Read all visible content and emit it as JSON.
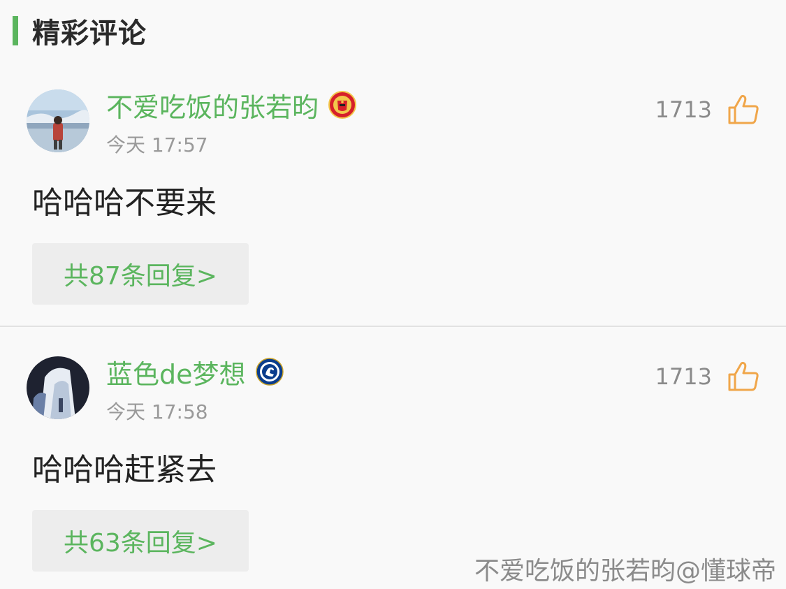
{
  "section": {
    "title": "精彩评论"
  },
  "comments": [
    {
      "username": "不爱吃饭的张若昀",
      "team_badge": "manchester-united-badge",
      "time": "今天 17:57",
      "likes": "1713",
      "content": "哈哈哈不要来",
      "replies_label": "共87条回复>"
    },
    {
      "username": "蓝色de梦想",
      "team_badge": "chelsea-badge",
      "time": "今天 17:58",
      "likes": "1713",
      "content": "哈哈哈赶紧去",
      "replies_label": "共63条回复>"
    }
  ],
  "watermark": "不爱吃饭的张若昀@懂球帝",
  "colors": {
    "accent": "#5bb55e",
    "like_icon": "#f0a64a",
    "reply_bg": "#ededed"
  }
}
